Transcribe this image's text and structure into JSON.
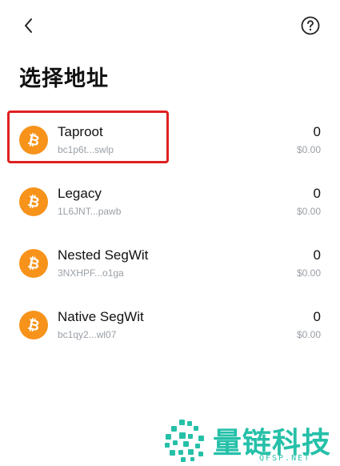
{
  "header": {
    "back_icon": "chevron-left-icon",
    "help_icon": "question-circle-icon",
    "title": "选择地址"
  },
  "addresses": [
    {
      "name": "Taproot",
      "address": "bc1p6t...swlp",
      "amount": "0",
      "fiat": "$0.00",
      "selected": true
    },
    {
      "name": "Legacy",
      "address": "1L6JNT...pawb",
      "amount": "0",
      "fiat": "$0.00",
      "selected": false
    },
    {
      "name": "Nested SegWit",
      "address": "3NXHPF...o1ga",
      "amount": "0",
      "fiat": "$0.00",
      "selected": false
    },
    {
      "name": "Native SegWit",
      "address": "bc1qy2...wl07",
      "amount": "0",
      "fiat": "$0.00",
      "selected": false
    }
  ],
  "coin": {
    "icon": "bitcoin-icon",
    "color": "#f7931a"
  },
  "highlight_color": "#e02020",
  "watermark": {
    "text": "量链科技",
    "domain": "QFSP.NET",
    "color": "#25c0a8"
  }
}
